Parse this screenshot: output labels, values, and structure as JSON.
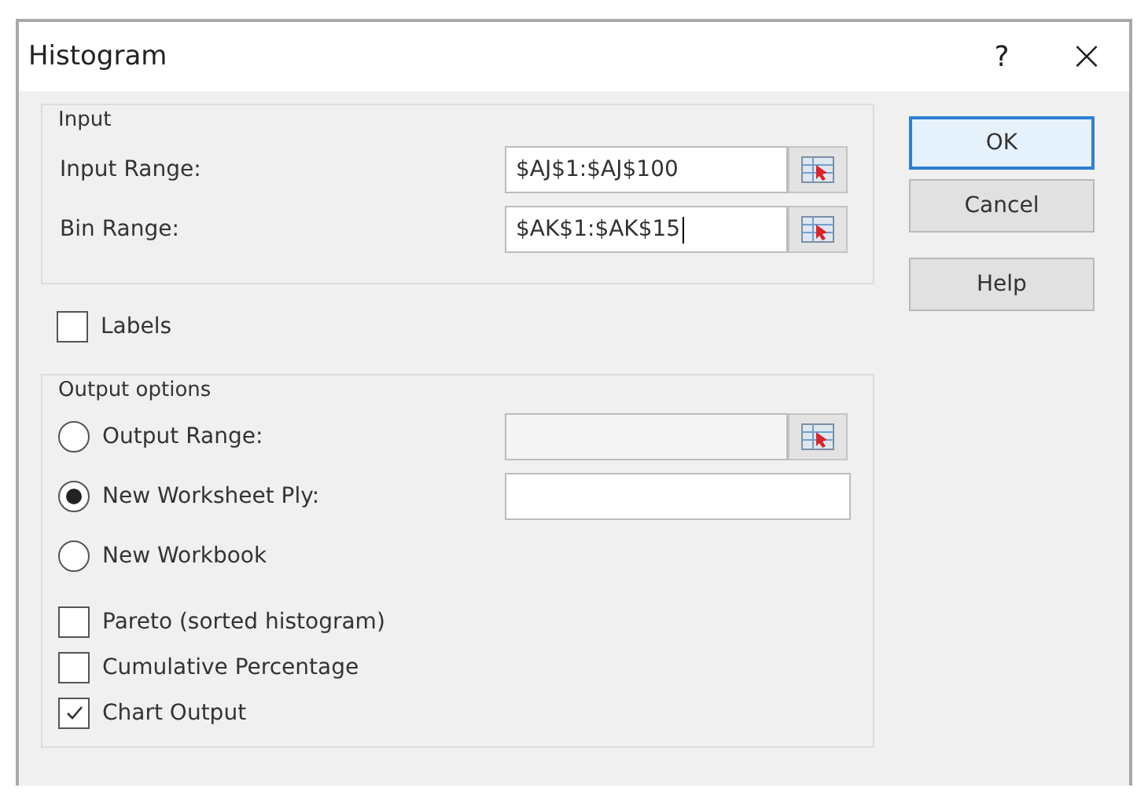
{
  "window": {
    "title": "Histogram",
    "help_glyph": "?",
    "close_glyph": "×"
  },
  "input_group": {
    "title": "Input",
    "fields": [
      {
        "label": "Input Range:",
        "value": "$AJ$1:$AJ$100",
        "caret": false
      },
      {
        "label": "Bin Range:",
        "value": "$AK$1:$AK$15",
        "caret": true
      }
    ]
  },
  "labels_checkbox": {
    "label": "Labels",
    "checked": false
  },
  "output_group": {
    "title": "Output options",
    "options": [
      {
        "label": "Output Range:",
        "selected": false,
        "kind": "range"
      },
      {
        "label": "New Worksheet Ply:",
        "selected": true,
        "kind": "text"
      },
      {
        "label": "New Workbook",
        "selected": false,
        "kind": "plain"
      }
    ],
    "checkboxes": [
      {
        "label": "Pareto (sorted histogram)",
        "checked": false
      },
      {
        "label": "Cumulative Percentage",
        "checked": false
      },
      {
        "label": "Chart Output",
        "checked": true
      }
    ]
  },
  "buttons": [
    {
      "label": "OK",
      "default": true
    },
    {
      "label": "Cancel",
      "default": false
    },
    {
      "label": "Help",
      "default": false
    }
  ]
}
